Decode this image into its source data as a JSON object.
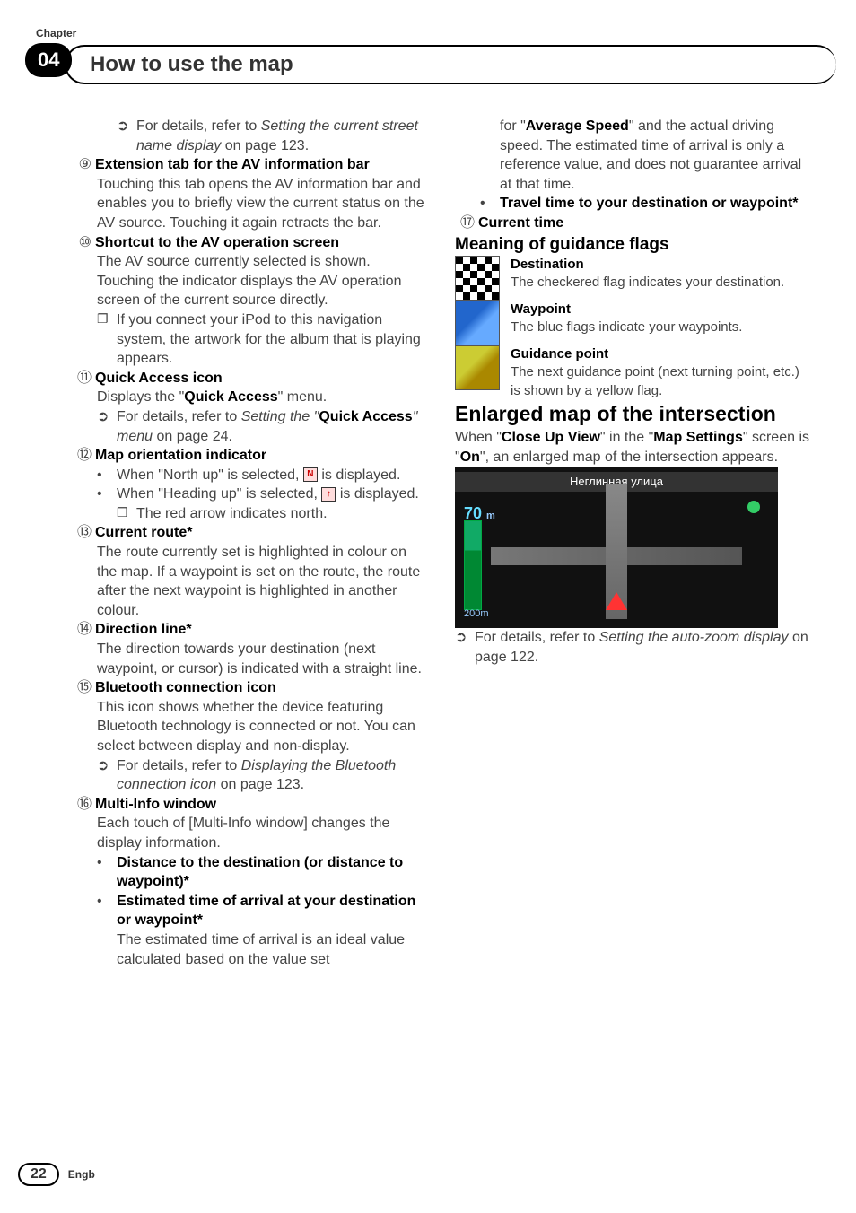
{
  "header": {
    "chapter_label": "Chapter",
    "chapter_num": "04",
    "title": "How to use the map"
  },
  "left": {
    "ref_a": "For details, refer to ",
    "ref_a_italic": "Setting the current street name display",
    "ref_a_tail": " on page 123.",
    "i9_num": "⑨",
    "i9_title": "Extension tab for the AV information bar",
    "i9_body": "Touching this tab opens the AV information bar and enables you to briefly view the current status on the AV source. Touching it again retracts the bar.",
    "i10_num": "⑩",
    "i10_title": "Shortcut to the AV operation screen",
    "i10_body": "The AV source currently selected is shown. Touching the indicator displays the AV operation screen of the current source directly.",
    "i10_sub": "If you connect your iPod to this navigation system, the artwork for the album that is playing appears.",
    "i11_num": "⑪",
    "i11_title": "Quick Access icon",
    "i11_body_a": "Displays the \"",
    "i11_body_b": "Quick Access",
    "i11_body_c": "\" menu.",
    "i11_ref_a": "For details, refer to ",
    "i11_ref_b": "Setting the \"",
    "i11_ref_c": "Quick Access",
    "i11_ref_d": "\" menu",
    "i11_ref_e": " on page 24.",
    "i12_num": "⑫",
    "i12_title": "Map orientation indicator",
    "i12_b1a": "When \"North up\" is selected, ",
    "i12_b1_icon": "N",
    "i12_b1b": " is displayed.",
    "i12_b2a": "When \"Heading up\" is selected, ",
    "i12_b2_icon": "↑",
    "i12_b2b": " is displayed.",
    "i12_sub": "The red arrow indicates north.",
    "i13_num": "⑬",
    "i13_title": "Current route*",
    "i13_body": "The route currently set is highlighted in colour on the map. If a waypoint is set on the route, the route after the next waypoint is highlighted in another colour.",
    "i14_num": "⑭",
    "i14_title": "Direction line*",
    "i14_body": "The direction towards your destination (next waypoint, or cursor) is indicated with a straight line.",
    "i15_num": "⑮",
    "i15_title": "Bluetooth connection icon",
    "i15_body": "This icon shows whether the device featuring Bluetooth technology is connected or not. You can select between display and non-display.",
    "i15_ref_a": "For details, refer to ",
    "i15_ref_b": "Displaying the Bluetooth connection icon",
    "i15_ref_c": " on page 123.",
    "i16_num": "⑯",
    "i16_title": "Multi-Info window",
    "i16_body": "Each touch of [Multi-Info window] changes the display information.",
    "i16_b1": "Distance to the destination (or distance to waypoint)*",
    "i16_b2": "Estimated time of arrival at your destination or waypoint*",
    "i16_b2_body": "The estimated time of arrival is an ideal value calculated based on the value set"
  },
  "right": {
    "cont_a": "for \"",
    "cont_b": "Average Speed",
    "cont_c": "\" and the actual driving speed. The estimated time of arrival is only a reference value, and does not guarantee arrival at that time.",
    "b3": "Travel time to your destination or waypoint*",
    "i17_num": "⑰",
    "i17_title": "Current time",
    "flags_h": "Meaning of guidance flags",
    "f1_t": "Destination",
    "f1_b": "The checkered flag indicates your destination.",
    "f2_t": "Waypoint",
    "f2_b": "The blue flags indicate your waypoints.",
    "f3_t": "Guidance point",
    "f3_b": "The next guidance point (next turning point, etc.) is shown by a yellow flag.",
    "enlarged_h": "Enlarged map of the intersection",
    "enlarged_a": "When \"",
    "enlarged_b": "Close Up View",
    "enlarged_c": "\" in the \"",
    "enlarged_d": "Map Settings",
    "enlarged_e": "\" screen is \"",
    "enlarged_f": "On",
    "enlarged_g": "\", an enlarged map of the intersection appears.",
    "map_street": "Неглинная улица",
    "map_dist": "70",
    "map_dist_unit": "m",
    "map_scale": "200m",
    "ref2_a": "For details, refer to ",
    "ref2_b": "Setting the auto-zoom display",
    "ref2_c": " on page 122."
  },
  "footer": {
    "page": "22",
    "lang": "Engb"
  }
}
